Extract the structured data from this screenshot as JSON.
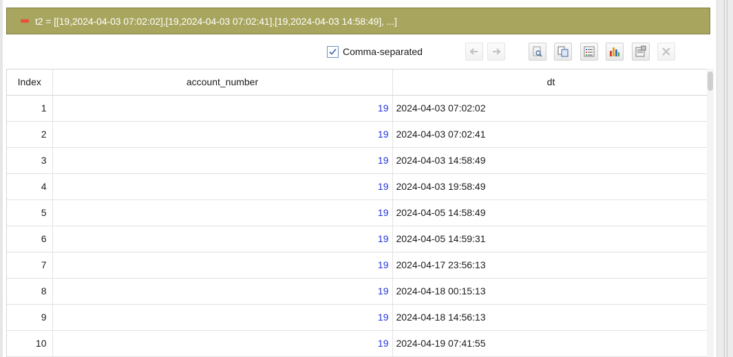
{
  "variable": {
    "header_text": "t2 = [[19,2024-04-03 07:02:02],[19,2024-04-03 07:02:41],[19,2024-04-03 14:58:49], ...]"
  },
  "toolbar": {
    "comma_separated_label": "Comma-separated",
    "comma_separated_checked": true,
    "buttons": [
      "back-arrow-icon",
      "forward-arrow-icon",
      "inspect-icon",
      "copy-icon",
      "list-icon",
      "chart-icon",
      "properties-icon",
      "close-icon"
    ]
  },
  "table": {
    "columns": [
      "Index",
      "account_number",
      "dt"
    ],
    "rows": [
      {
        "index": "1",
        "account_number": "19",
        "dt": "2024-04-03 07:02:02"
      },
      {
        "index": "2",
        "account_number": "19",
        "dt": "2024-04-03 07:02:41"
      },
      {
        "index": "3",
        "account_number": "19",
        "dt": "2024-04-03 14:58:49"
      },
      {
        "index": "4",
        "account_number": "19",
        "dt": "2024-04-03 19:58:49"
      },
      {
        "index": "5",
        "account_number": "19",
        "dt": "2024-04-05 14:58:49"
      },
      {
        "index": "6",
        "account_number": "19",
        "dt": "2024-04-05 14:59:31"
      },
      {
        "index": "7",
        "account_number": "19",
        "dt": "2024-04-17 23:56:13"
      },
      {
        "index": "8",
        "account_number": "19",
        "dt": "2024-04-18 00:15:13"
      },
      {
        "index": "9",
        "account_number": "19",
        "dt": "2024-04-18 14:56:13"
      },
      {
        "index": "10",
        "account_number": "19",
        "dt": "2024-04-19 07:41:55"
      }
    ]
  },
  "colors": {
    "header_bg": "#a8a65e",
    "collapse_icon": "#e7533a",
    "number_text": "#2233dd"
  }
}
